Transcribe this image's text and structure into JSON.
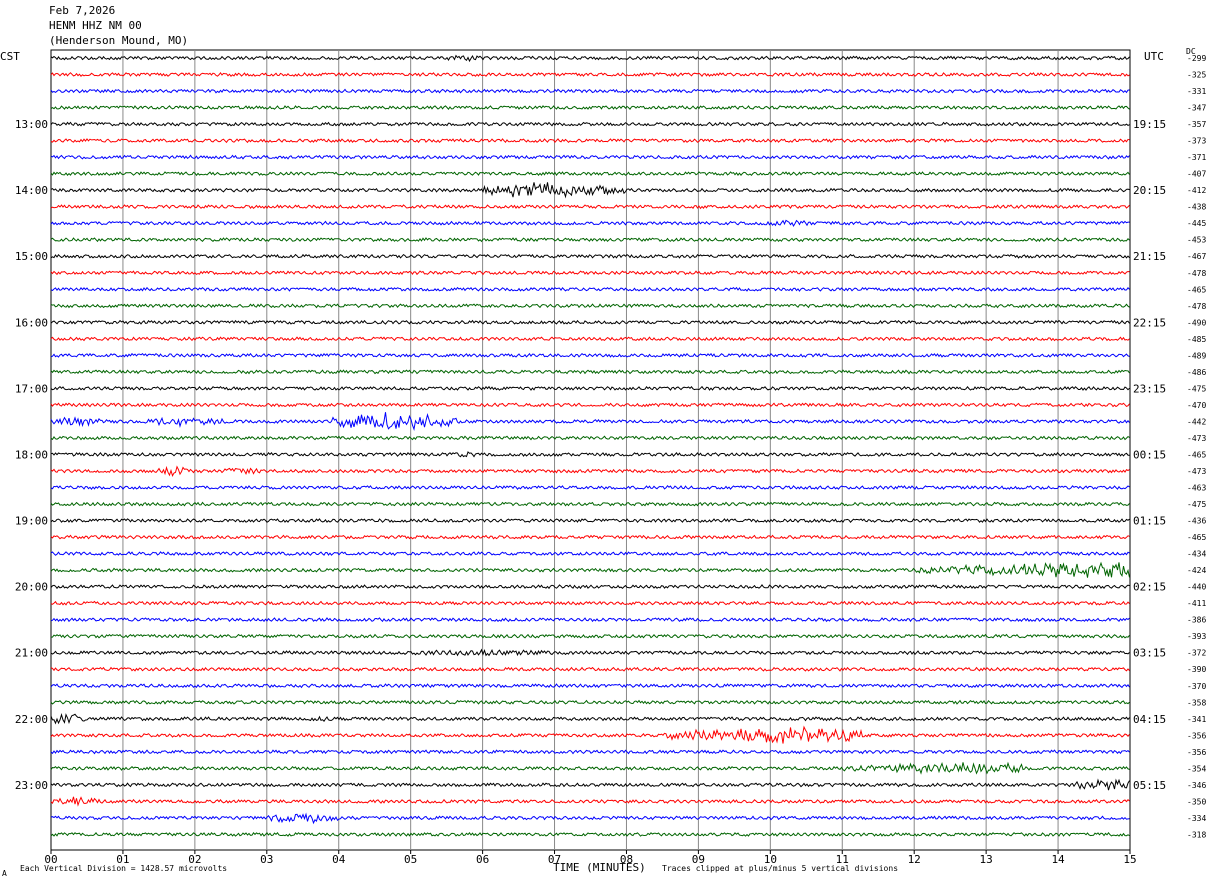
{
  "header": {
    "date": "Feb 7,2026",
    "station": "HENM HHZ NM 00",
    "location": "(Henderson Mound, MO)"
  },
  "left_timezone": "CST",
  "right_timezone": "UTC",
  "dc_label": "DC",
  "footer": {
    "scale_note": "Each Vertical Division = 1428.57 microvolts",
    "axis_title": "TIME (MINUTES)",
    "clip_note": "Traces clipped at plus/minus 5 vertical divisions",
    "corner_mark": "A"
  },
  "chart_data": {
    "type": "line",
    "title": "",
    "xlabel": "TIME (MINUTES)",
    "xlim": [
      0,
      15
    ],
    "x_ticks": [
      "00",
      "01",
      "02",
      "03",
      "04",
      "05",
      "06",
      "07",
      "08",
      "09",
      "10",
      "11",
      "12",
      "13",
      "14",
      "15"
    ],
    "hour_labels_cst": [
      "13:00",
      "14:00",
      "15:00",
      "16:00",
      "17:00",
      "18:00",
      "19:00",
      "20:00",
      "21:00",
      "22:00",
      "23:00"
    ],
    "hour_labels_utc": [
      "19:15",
      "20:15",
      "21:15",
      "22:15",
      "23:15",
      "00:15",
      "01:15",
      "02:15",
      "03:15",
      "04:15",
      "05:15"
    ],
    "trace_colors": [
      "#000000",
      "#ff0000",
      "#0000ff",
      "#006400"
    ],
    "dc_offsets": [
      "-299",
      "-325",
      "-331",
      "-347",
      "-357",
      "-373",
      "-371",
      "-407",
      "-412",
      "-438",
      "-445",
      "-453",
      "-467",
      "-478",
      "-465",
      "-478",
      "-490",
      "-485",
      "-489",
      "-486",
      "-475",
      "-470",
      "-442",
      "-473",
      "-465",
      "-473",
      "-463",
      "-475",
      "-436",
      "-465",
      "-434",
      "-424",
      "-440",
      "-411",
      "-386",
      "-393",
      "-372",
      "-390",
      "-370",
      "-358",
      "-341",
      "-356",
      "-356",
      "-354",
      "-346",
      "-350",
      "-334",
      "-318"
    ],
    "events": [
      {
        "trace": 0,
        "minute_start": 5.5,
        "minute_end": 6.0,
        "amp": 2
      },
      {
        "trace": 8,
        "minute_start": 6.0,
        "minute_end": 8.0,
        "amp": 8,
        "peak_minute": 6.7
      },
      {
        "trace": 10,
        "minute_start": 9.9,
        "minute_end": 10.6,
        "amp": 2
      },
      {
        "trace": 22,
        "minute_start": 0.0,
        "minute_end": 0.7,
        "amp": 5
      },
      {
        "trace": 22,
        "minute_start": 1.3,
        "minute_end": 2.5,
        "amp": 4
      },
      {
        "trace": 22,
        "minute_start": 3.9,
        "minute_end": 5.7,
        "amp": 9,
        "peak_minute": 4.7
      },
      {
        "trace": 24,
        "minute_start": 5.6,
        "minute_end": 5.9,
        "amp": 3
      },
      {
        "trace": 25,
        "minute_start": 1.5,
        "minute_end": 1.9,
        "amp": 5
      },
      {
        "trace": 25,
        "minute_start": 2.4,
        "minute_end": 2.9,
        "amp": 4
      },
      {
        "trace": 31,
        "minute_start": 12.0,
        "minute_end": 15.0,
        "amp": 8,
        "peak_minute": 14.7
      },
      {
        "trace": 36,
        "minute_start": 5.0,
        "minute_end": 7.0,
        "amp": 2
      },
      {
        "trace": 40,
        "minute_start": 0.0,
        "minute_end": 0.5,
        "amp": 8
      },
      {
        "trace": 40,
        "minute_start": 3.6,
        "minute_end": 3.9,
        "amp": 2
      },
      {
        "trace": 41,
        "minute_start": 8.5,
        "minute_end": 11.3,
        "amp": 9,
        "peak_minute": 10.4
      },
      {
        "trace": 43,
        "minute_start": 11.0,
        "minute_end": 13.5,
        "amp": 5,
        "peak_minute": 12.7
      },
      {
        "trace": 44,
        "minute_start": 14.2,
        "minute_end": 15.0,
        "amp": 6,
        "peak_minute": 14.7
      },
      {
        "trace": 45,
        "minute_start": 0.0,
        "minute_end": 0.7,
        "amp": 4
      },
      {
        "trace": 46,
        "minute_start": 3.0,
        "minute_end": 4.0,
        "amp": 5
      }
    ]
  }
}
